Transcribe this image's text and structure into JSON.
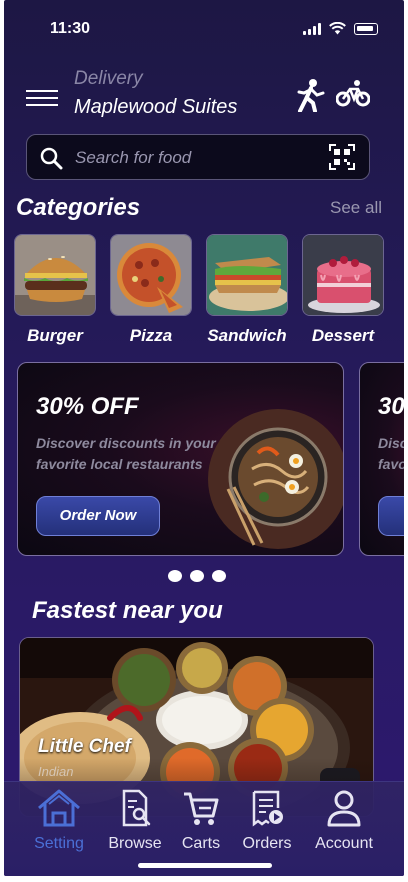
{
  "status_bar": {
    "time": "11:30"
  },
  "header": {
    "mode": "Delivery",
    "address": "Maplewood Suites",
    "mode_icons": [
      "walking-icon",
      "bicycle-icon"
    ]
  },
  "search": {
    "placeholder": "Search  for food"
  },
  "categories": {
    "title": "Categories",
    "see_all": "See all",
    "items": [
      {
        "label": "Burger"
      },
      {
        "label": "Pizza"
      },
      {
        "label": "Sandwich"
      },
      {
        "label": "Dessert"
      }
    ]
  },
  "promos": [
    {
      "title": "30% OFF",
      "description": "Discover discounts in your favorite local restaurants",
      "button": "Order Now"
    },
    {
      "title": "30",
      "description_lines": [
        "Disc",
        "favo"
      ],
      "button": "O"
    }
  ],
  "carousel": {
    "pages": 3
  },
  "fastest": {
    "title": "Fastest near you",
    "restaurants": [
      {
        "name": "Little Chef",
        "cuisine": "Indian"
      }
    ]
  },
  "bottom_nav": {
    "active": "Setting",
    "items": [
      {
        "label": "Setting",
        "icon": "home-icon"
      },
      {
        "label": "Browse",
        "icon": "browse-icon"
      },
      {
        "label": "Carts",
        "icon": "cart-icon"
      },
      {
        "label": "Orders",
        "icon": "orders-icon"
      },
      {
        "label": "Account",
        "icon": "account-icon"
      }
    ]
  },
  "colors": {
    "background": "#241a57",
    "accent": "#4b6fd6",
    "button": "#2e3a8f"
  }
}
